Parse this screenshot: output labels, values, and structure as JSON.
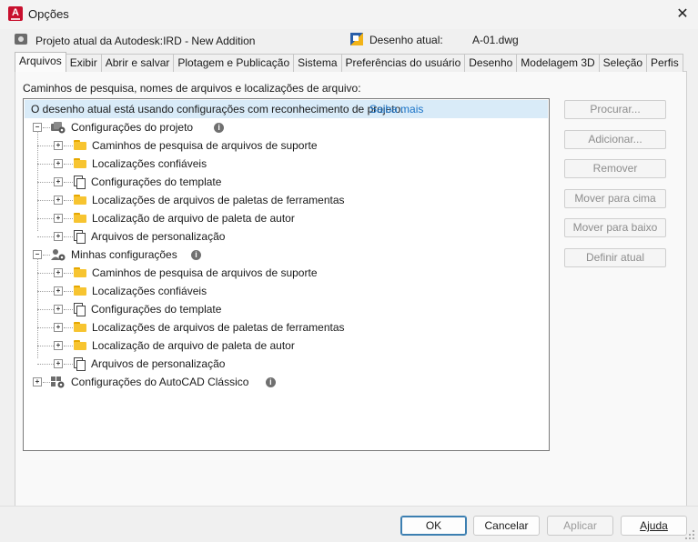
{
  "window": {
    "title": "Opções",
    "app_icon_letter": "A"
  },
  "header": {
    "project_label": "Projeto atual da Autodesk:IRD - New Addition",
    "drawing_label": "Desenho atual:",
    "drawing_value": "A-01.dwg"
  },
  "tabs": [
    {
      "label": "Arquivos",
      "active": true
    },
    {
      "label": "Exibir"
    },
    {
      "label": "Abrir e salvar"
    },
    {
      "label": "Plotagem e Publicação"
    },
    {
      "label": "Sistema"
    },
    {
      "label": "Preferências do usuário"
    },
    {
      "label": "Desenho"
    },
    {
      "label": "Modelagem 3D"
    },
    {
      "label": "Seleção"
    },
    {
      "label": "Perfis"
    }
  ],
  "files_panel": {
    "section_label": "Caminhos de pesquisa, nomes de arquivos e localizações de arquivo:",
    "info_text": "O desenho atual está usando configurações com reconhecimento de projeto.",
    "learn_more": "Saiba mais",
    "groups": [
      {
        "label": "Configurações do projeto",
        "icon": "project-settings-icon",
        "expanded": true,
        "items": [
          {
            "label": "Caminhos de pesquisa de arquivos de suporte",
            "icon": "folder"
          },
          {
            "label": "Localizações confiáveis",
            "icon": "folder"
          },
          {
            "label": "Configurações do template",
            "icon": "documents"
          },
          {
            "label": "Localizações de arquivos de paletas de ferramentas",
            "icon": "folder"
          },
          {
            "label": "Localização de arquivo de paleta de autor",
            "icon": "folder"
          },
          {
            "label": "Arquivos de personalização",
            "icon": "documents"
          }
        ]
      },
      {
        "label": "Minhas configurações",
        "icon": "user-settings-icon",
        "expanded": true,
        "items": [
          {
            "label": "Caminhos de pesquisa de arquivos de suporte",
            "icon": "folder"
          },
          {
            "label": "Localizações confiáveis",
            "icon": "folder"
          },
          {
            "label": "Configurações do template",
            "icon": "documents"
          },
          {
            "label": "Localizações de arquivos de paletas de ferramentas",
            "icon": "folder"
          },
          {
            "label": "Localização de arquivo de paleta de autor",
            "icon": "folder"
          },
          {
            "label": "Arquivos de personalização",
            "icon": "documents"
          }
        ]
      },
      {
        "label": "Configurações do AutoCAD Clássico",
        "icon": "classic-settings-icon",
        "expanded": false,
        "items": []
      }
    ],
    "side_buttons": [
      "Procurar...",
      "Adicionar...",
      "Remover",
      "Mover para cima",
      "Mover para baixo",
      "Definir atual"
    ]
  },
  "footer": {
    "ok": "OK",
    "cancel": "Cancelar",
    "apply": "Aplicar",
    "help": "Ajuda"
  },
  "colors": {
    "accent": "#1a73c7",
    "info_bar": "#d9ebf8",
    "folder": "#f7c430",
    "app_icon": "#c8102e"
  }
}
